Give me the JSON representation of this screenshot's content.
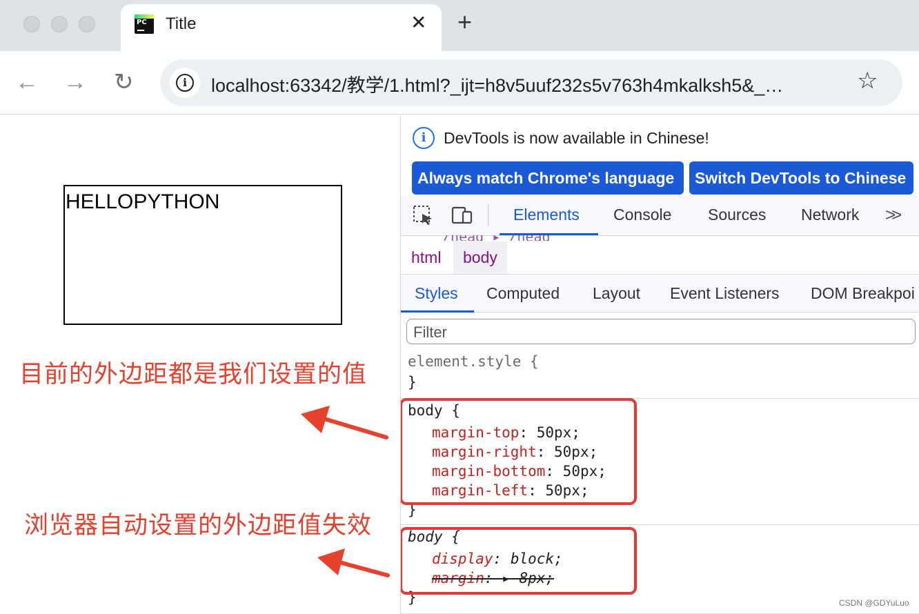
{
  "browser": {
    "tab_title": "Title",
    "tab_close": "✕",
    "new_tab": "+",
    "back": "←",
    "forward": "→",
    "reload": "↻",
    "url": "localhost:63342/教学/1.html?_ijt=h8v5uuf232s5v763h4mkalksh5&_…",
    "bookmark": "☆",
    "site_info": "i"
  },
  "page": {
    "box_text": "HELLOPYTHON"
  },
  "annotations": {
    "note1": "目前的外边距都是我们设置的值",
    "note2": "浏览器自动设置的外边距值失效",
    "color": "#e5412d"
  },
  "devtools": {
    "info_icon": "i",
    "info_text": "DevTools is now available in Chinese!",
    "btn_match": "Always match Chrome's language",
    "btn_switch": "Switch DevTools to Chinese",
    "tabs": [
      "Elements",
      "Console",
      "Sources",
      "Network"
    ],
    "more": ">>",
    "dom_peek": "/head  ▸ /head",
    "breadcrumbs": [
      "html",
      "body"
    ],
    "subtabs": [
      "Styles",
      "Computed",
      "Layout",
      "Event Listeners",
      "DOM Breakpoi"
    ],
    "filter_placeholder": "Filter",
    "element_style_open": "element.style {",
    "element_style_close": "}",
    "rule1": {
      "selector": "body {",
      "decls": [
        {
          "prop": "margin-top",
          "value": " 50px;"
        },
        {
          "prop": "margin-right",
          "value": " 50px;"
        },
        {
          "prop": "margin-bottom",
          "value": " 50px;"
        },
        {
          "prop": "margin-left",
          "value": " 50px;"
        }
      ],
      "close": "}"
    },
    "rule2": {
      "selector": "body {",
      "display_prop": "display",
      "display_value": " block;",
      "margin_prop": "margin",
      "margin_arrow": "▸",
      "margin_value": " 8px;",
      "close": "}"
    },
    "accent": "#1a5ad7"
  },
  "watermark": "CSDN @GDYuLuo"
}
